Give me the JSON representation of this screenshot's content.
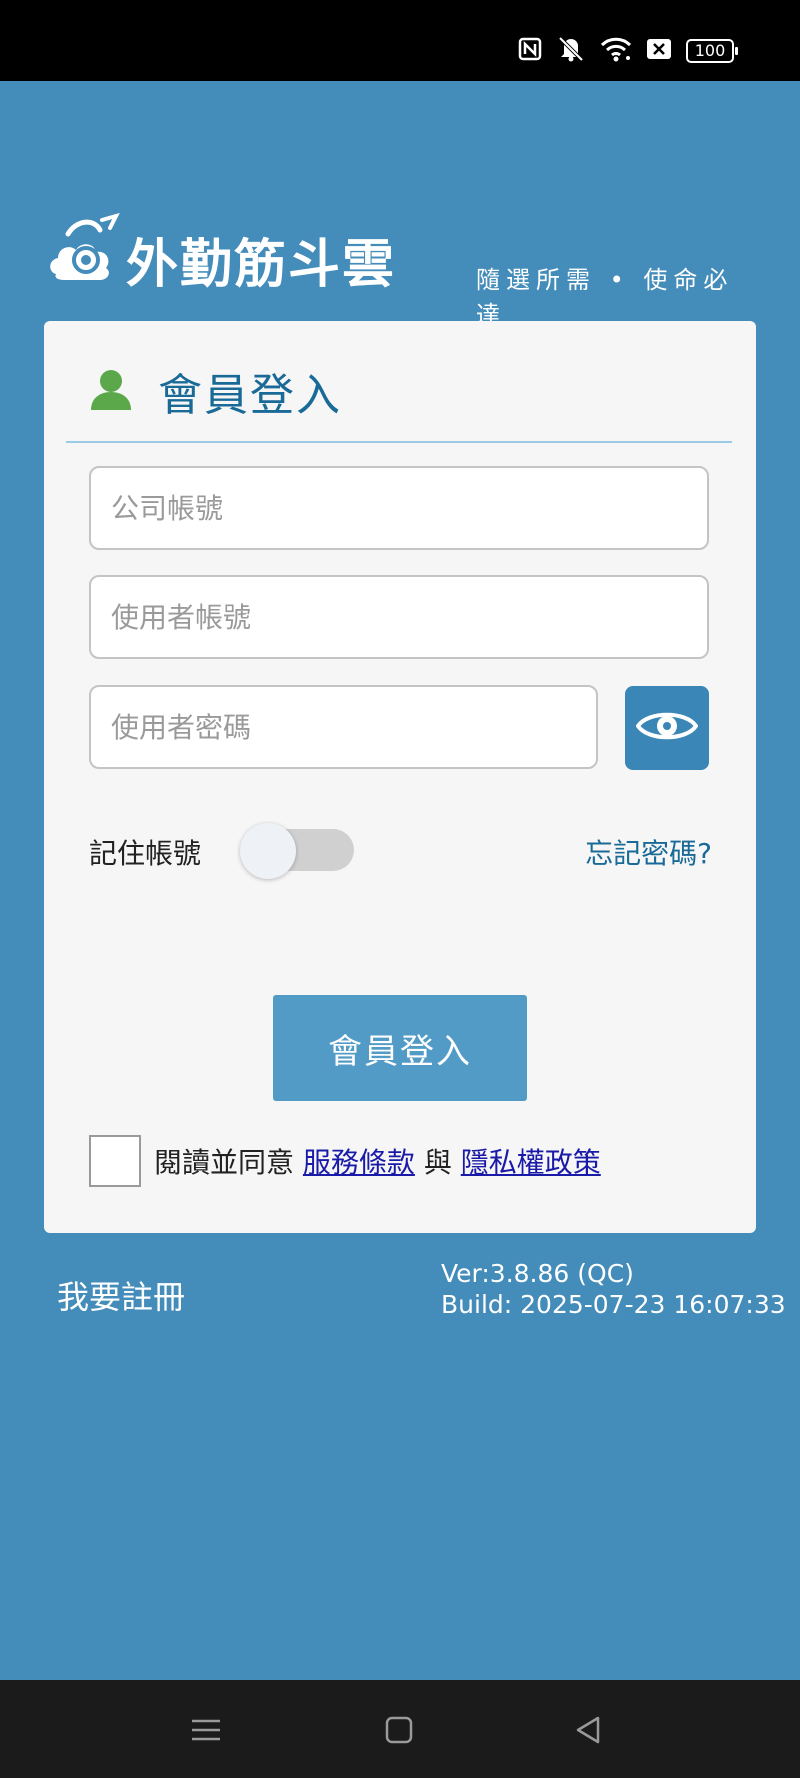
{
  "status_bar": {
    "battery": "100",
    "icons": [
      "nfc-icon",
      "mute-vibrate-icon",
      "wifi-icon",
      "close-box-icon",
      "battery-icon"
    ]
  },
  "logo": {
    "title": "外勤筋斗雲",
    "tagline": "隨選所需 • 使命必達"
  },
  "login": {
    "title": "會員登入",
    "company_placeholder": "公司帳號",
    "company_value": "",
    "user_placeholder": "使用者帳號",
    "user_value": "",
    "password_placeholder": "使用者密碼",
    "password_value": "",
    "remember_label": "記住帳號",
    "remember_on": false,
    "forgot_link": "忘記密碼?",
    "login_button": "會員登入",
    "agree_prefix": "閱讀並同意",
    "terms_link": "服務條款",
    "and_text": "與",
    "privacy_link": "隱私權政策"
  },
  "footer": {
    "register_link": "我要註冊",
    "version": "Ver:3.8.86 (QC)",
    "build": "Build: 2025-07-23 16:07:33"
  },
  "colors": {
    "background": "#448cba",
    "accent": "#1a6a98",
    "button": "#519bc6",
    "user_icon": "#5aa84a"
  }
}
